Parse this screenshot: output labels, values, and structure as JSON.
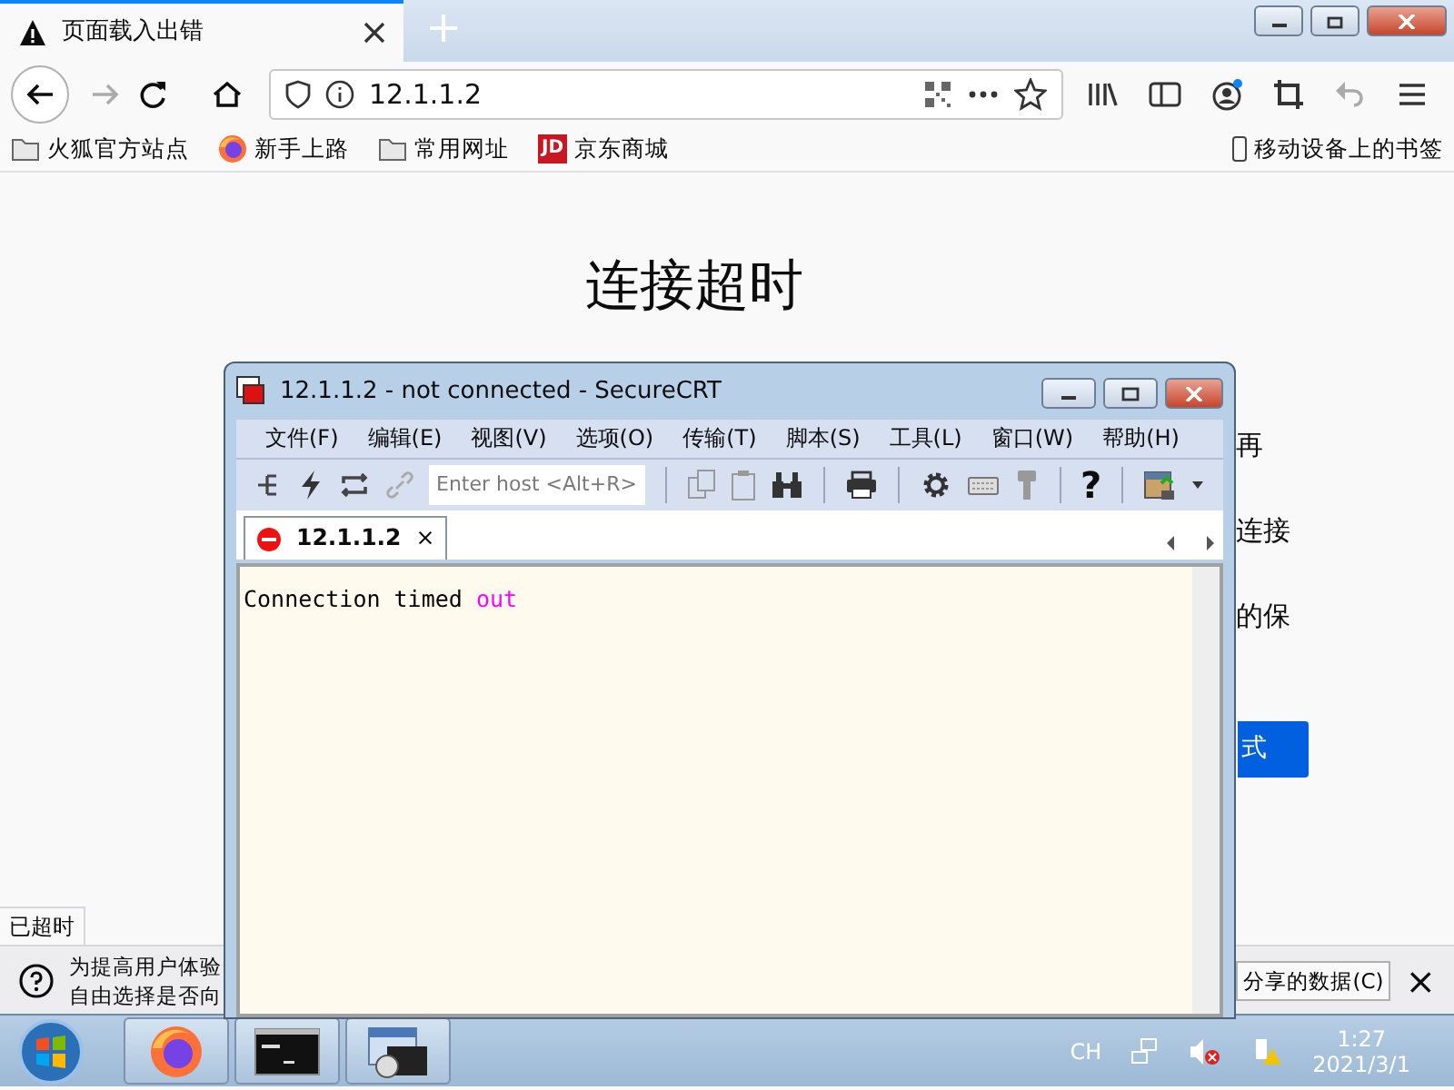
{
  "browser": {
    "tabs": [
      {
        "title": "页面载入出错",
        "selected": true
      }
    ],
    "new_tab": "+",
    "address": "12.1.1.2",
    "bookmarks": [
      {
        "label": "火狐官方站点",
        "kind": "folder"
      },
      {
        "label": "新手上路",
        "kind": "firefox"
      },
      {
        "label": "常用网址",
        "kind": "folder"
      },
      {
        "label": "京东商城",
        "kind": "jd",
        "logo": "JD"
      }
    ],
    "mobile_bookmarks": "移动设备上的书签",
    "page": {
      "heading": "连接超时",
      "fragments": [
        "再",
        "连接",
        "的保"
      ],
      "button": "式"
    },
    "status": "已超时",
    "notification": {
      "lines": [
        "为提高用户体验",
        "自由选择是否向"
      ],
      "button": "分享的数据(C)",
      "close": "×"
    }
  },
  "securecrt": {
    "title": "12.1.1.2 - not connected - SecureCRT",
    "menu": [
      "文件(F)",
      "编辑(E)",
      "视图(V)",
      "选项(O)",
      "传输(T)",
      "脚本(S)",
      "工具(L)",
      "窗口(W)",
      "帮助(H)"
    ],
    "host_placeholder": "Enter host <Alt+R>",
    "help": "?",
    "tabs": [
      {
        "label": "12.1.1.2",
        "selected": true,
        "close": "×"
      }
    ],
    "terminal": [
      {
        "text": "Connection timed ",
        "color": "#000000"
      },
      {
        "text": "out",
        "color": "#ff00ff"
      }
    ]
  },
  "taskbar": {
    "apps": [
      {
        "kind": "firefox"
      },
      {
        "kind": "cmd"
      },
      {
        "kind": "securecrt"
      }
    ],
    "tray": {
      "language": "CH",
      "time": "1:27",
      "date": "2021/3/1"
    }
  }
}
